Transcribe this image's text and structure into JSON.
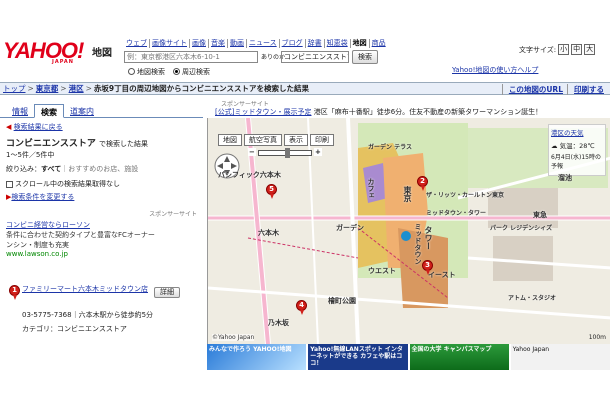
{
  "header": {
    "logo": "YAHOO!",
    "logo_sub": "JAPAN",
    "service": "地図",
    "nav": [
      "ウェブ",
      "画像サイト",
      "画像",
      "音楽",
      "動画",
      "ニュース",
      "ブログ",
      "辞書",
      "知恵袋",
      "地図",
      "商品"
    ],
    "nav_current_index": 9,
    "address_placeholder": "例：東京都港区六本木6-10-1",
    "ofuro": "ありのか",
    "keyword": "コンビニエンスストア",
    "search_button": "検索",
    "radio_map": "地図検索",
    "radio_nearby": "周辺検索",
    "font_size_label": "文字サイズ:",
    "font_small": "小",
    "font_mid": "中",
    "font_large": "大",
    "hint_link": "Yahoo!地図の使い方ヘルプ"
  },
  "breadcrumb": {
    "top": "トップ",
    "pref": "東京都",
    "ward": "港区",
    "text": "赤坂9丁目の周辺地図からコンビニエンスストアを検索した結果",
    "right_links": [
      "この地図のURL",
      "印刷する"
    ]
  },
  "left": {
    "tabs": [
      "情報",
      "検索",
      "道案内"
    ],
    "active_tab": 1,
    "back_link": "検索結果に戻る",
    "category": "コンビニエンスストア",
    "category_suffix": "で検索した結果",
    "count": "1～5件／5件中",
    "filter_label": "絞り込み：",
    "filter_all": "すべて",
    "filter_rest": "｜おすすめのお店、施設",
    "scroll_label": "スクロール中の検索結果取得なし",
    "cond_link": "検索条件を変更する",
    "sponsor": "スポンサーサイト",
    "ad_title": "コンビニ経営ならローソン",
    "ad_desc": "条件に合わせた契約タイプと豊富なFCオーナー",
    "ad_desc2": "ンシン・制度も充実",
    "ad_url": "www.lawson.co.jp",
    "results": [
      {
        "num": "1",
        "name": "ファミリーマート六本木ミッドタウン店",
        "tel": "03-5775-7368｜六本木駅から徒歩約5分",
        "category": "カテゴリ：コンビニエンスストア",
        "detail_button": "詳細"
      }
    ]
  },
  "map": {
    "sponsor": "スポンサーサイト",
    "ad_link": "[公式]ミッドタウン・展示予定",
    "ad_text": "港区「麻布十番駅」徒歩6分。住友不動産の新築タワーマンション誕生！",
    "tools": [
      "地図",
      "航空写真",
      "表示",
      "印刷"
    ],
    "zoom_out": "−",
    "zoom_in": "+",
    "weather_link": "港区の天気",
    "weather_mark": "気温：28℃",
    "weather_time": "6月4日(水)15時の予報",
    "copyright": "©Yahoo Japan",
    "scale": "100m",
    "labels": [
      "パシフィック六本木",
      "六本木",
      "ガーデン テラス",
      "カフェ",
      "ガーデン",
      "東京",
      "ミッドタウン",
      "タワー",
      "ウエスト",
      "イースト",
      "パーク レジデンシィズ",
      "ミッドタウン・タワー",
      "ザ・リッツ・カールトン東京",
      "東急",
      "溜池",
      "檜町公園",
      "乃木坂",
      "アトム・スタジオ"
    ]
  },
  "banners": [
    "みんなで作ろう YAHOO!地図",
    "Yahoo!無線LANスポット インターネットができる カフェや駅はココ！",
    "全国の大学 キャンパスマップ",
    "Yahoo Japan"
  ]
}
